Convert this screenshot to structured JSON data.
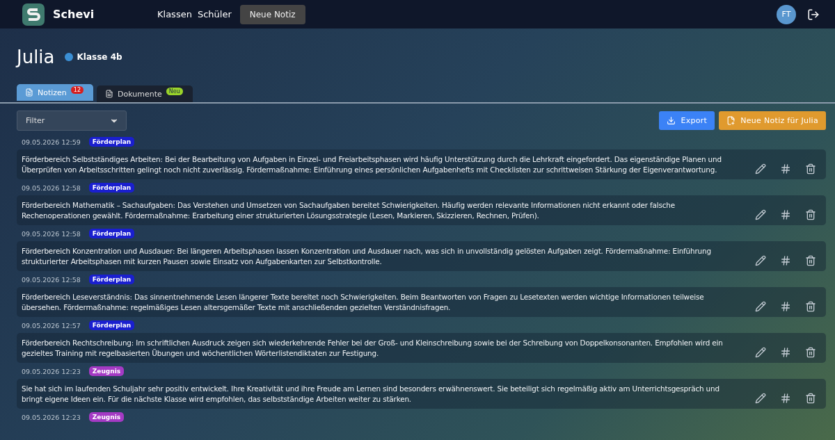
{
  "app": {
    "name": "Schevi"
  },
  "nav": [
    {
      "label": "Klassen",
      "kind": "link"
    },
    {
      "label": "Schüler",
      "kind": "link"
    },
    {
      "label": "Neue Notiz",
      "kind": "button"
    }
  ],
  "user": {
    "initials": "FT"
  },
  "student": {
    "name": "Julia",
    "class_label": "Klasse 4b",
    "color": "#3b8fd4"
  },
  "tabs": [
    {
      "label": "Notizen",
      "badge": "12",
      "selected": true,
      "kind": "count"
    },
    {
      "label": "Dokumente",
      "badge": "Neu",
      "selected": false,
      "kind": "new"
    }
  ],
  "filter": {
    "placeholder": "Filter"
  },
  "actions": [
    {
      "label": "Export",
      "kind": "export"
    },
    {
      "label": "Neue Notiz für Julia",
      "kind": "new-note"
    }
  ],
  "notes": [
    {
      "time": "09.05.2026 12:59",
      "tag": "Förderplan",
      "color": "#1a1fcf",
      "text": "Förderbereich Selbstständiges Arbeiten: Bei der Bearbeitung von Aufgaben in Einzel- und Freiarbeitsphasen wird häufig Unterstützung durch die Lehrkraft eingefordert. Das eigenständige Planen und Überprüfen von Arbeitsschritten gelingt noch nicht zuverlässig. Fördermaßnahme: Einführung eines persönlichen Aufgabenhefts mit Checklisten zur schrittweisen Stärkung der Eigenverantwortung."
    },
    {
      "time": "09.05.2026 12:58",
      "tag": "Förderplan",
      "color": "#1a1fcf",
      "text": "Förderbereich Mathematik – Sachaufgaben: Das Verstehen und Umsetzen von Sachaufgaben bereitet Schwierigkeiten. Häufig werden relevante Informationen nicht erkannt oder falsche Rechenoperationen gewählt. Fördermaßnahme: Erarbeitung einer strukturierten Lösungsstrategie (Lesen, Markieren, Skizzieren, Rechnen, Prüfen)."
    },
    {
      "time": "09.05.2026 12:58",
      "tag": "Förderplan",
      "color": "#1a1fcf",
      "text": "Förderbereich Konzentration und Ausdauer: Bei längeren Arbeitsphasen lassen Konzentration und Ausdauer nach, was sich in unvollständig gelösten Aufgaben zeigt. Fördermaßnahme: Einführung strukturierter Arbeitsphasen mit kurzen Pausen sowie Einsatz von Aufgabenkarten zur Selbstkontrolle."
    },
    {
      "time": "09.05.2026 12:58",
      "tag": "Förderplan",
      "color": "#1a1fcf",
      "text": "Förderbereich Leseverständnis: Das sinnentnehmende Lesen längerer Texte bereitet noch Schwierigkeiten. Beim Beantworten von Fragen zu Lesetexten werden wichtige Informationen teilweise übersehen. Fördermaßnahme: regelmäßiges Lesen altersgemäßer Texte mit anschließenden gezielten Verständnisfragen."
    },
    {
      "time": "09.05.2026 12:57",
      "tag": "Förderplan",
      "color": "#1a1fcf",
      "text": "Förderbereich Rechtschreibung: Im schriftlichen Ausdruck zeigen sich wiederkehrende Fehler bei der Groß- und Kleinschreibung sowie bei der Schreibung von Doppelkonsonanten. Empfohlen wird ein gezieltes Training mit regelbasierten Übungen und wöchentlichen Wörterlistendiktaten zur Festigung."
    },
    {
      "time": "09.05.2026 12:23",
      "tag": "Zeugnis",
      "color": "#a43ac4",
      "text": "Sie hat sich im laufenden Schuljahr sehr positiv entwickelt. Ihre Kreativität und ihre Freude am Lernen sind besonders erwähnenswert. Sie beteiligt sich regelmäßig aktiv am Unterrichtsgespräch und bringt eigene Ideen ein. Für die nächste Klasse wird empfohlen, das selbstständige Arbeiten weiter zu stärken."
    },
    {
      "time": "09.05.2026 12:23",
      "tag": "Zeugnis",
      "color": "#a43ac4"
    }
  ]
}
